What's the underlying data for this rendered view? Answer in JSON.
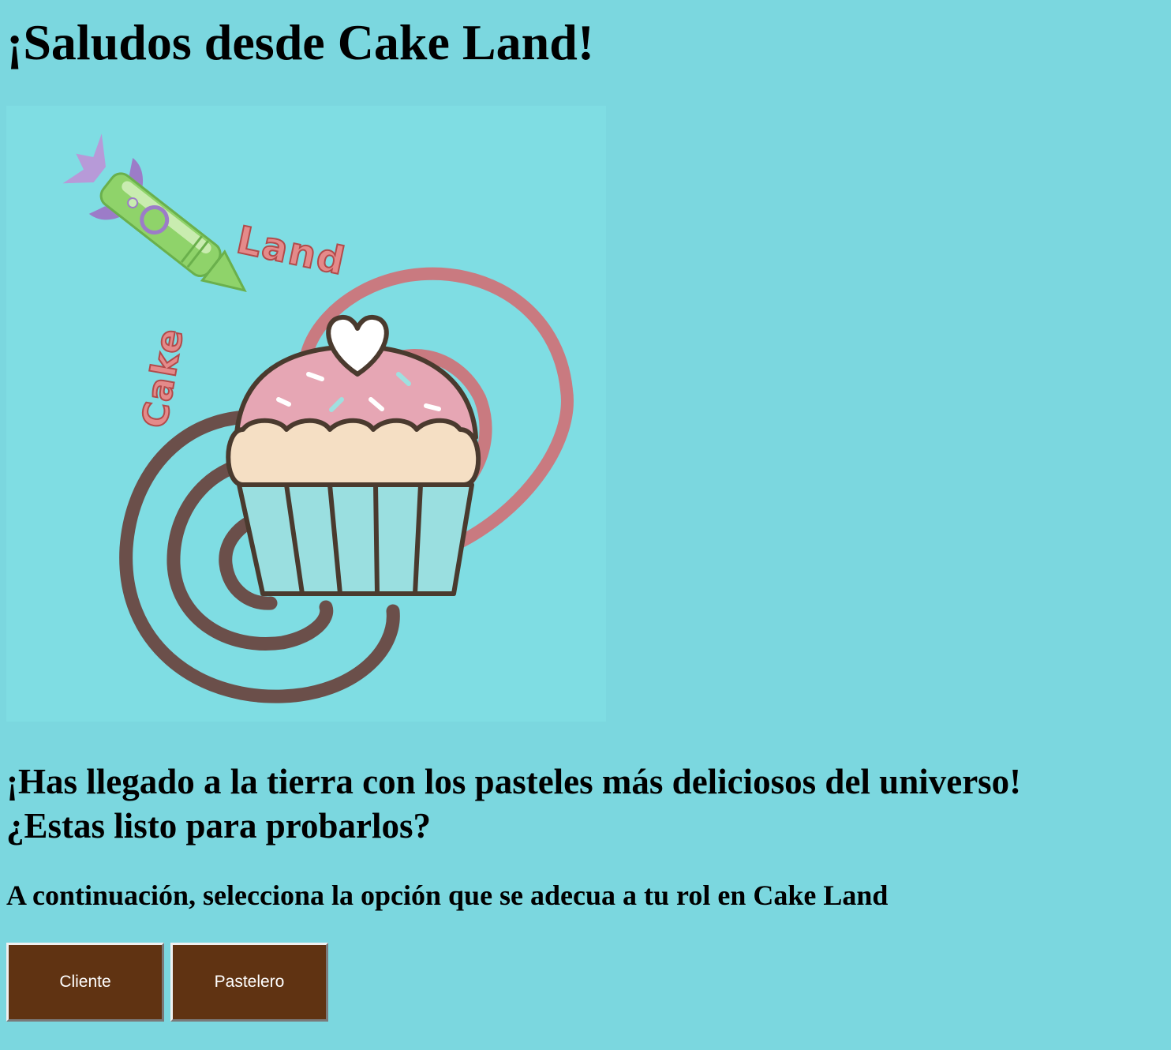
{
  "header": {
    "title": "¡Saludos desde Cake Land!"
  },
  "logo": {
    "word_top": "Land",
    "word_side": "Cake",
    "colors": {
      "background": "#7fdde3",
      "spiral_brown": "#6b4f4a",
      "spiral_pink": "#c97a80",
      "frosting": "#e6a6b4",
      "cream": "#f5dfc4",
      "liner": "#9adfe0",
      "rocket_green": "#8fd36a",
      "rocket_purple": "#b79ad8"
    }
  },
  "main": {
    "headline_line1": "¡Has llegado a la tierra con los pasteles más deliciosos del universo!",
    "headline_line2": "¿Estas listo para probarlos?",
    "prompt": "A continuación, selecciona la opción que se adecua a tu rol en Cake Land"
  },
  "buttons": {
    "cliente_label": "Cliente",
    "pastelero_label": "Pastelero",
    "color": "#603312"
  },
  "page": {
    "background": "#7bd7df"
  }
}
